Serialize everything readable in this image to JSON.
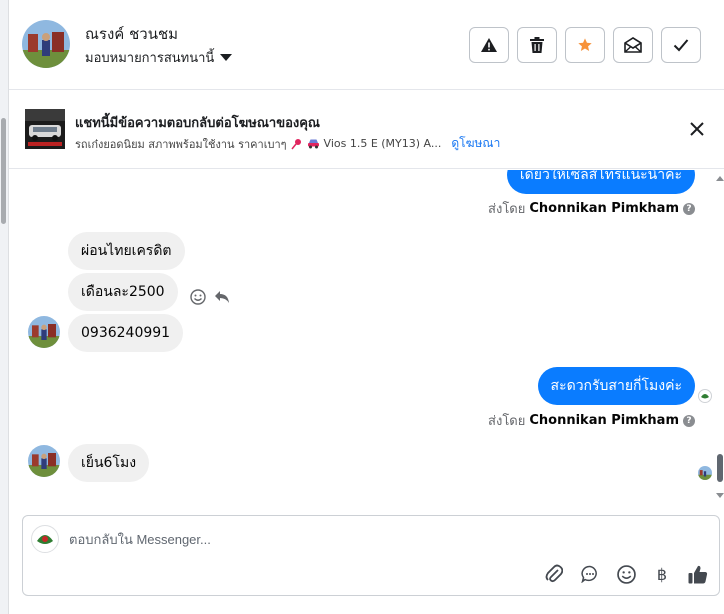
{
  "contact": {
    "name": "ณรงค์ ชวนชม",
    "assign_label": "มอบหมายการสนทนานี้"
  },
  "actions": [
    {
      "icon": "alert-triangle-icon",
      "name": "report-spam-button"
    },
    {
      "icon": "trash-icon",
      "name": "delete-button"
    },
    {
      "icon": "star-icon",
      "name": "star-button"
    },
    {
      "icon": "envelope-open-icon",
      "name": "mark-unread-button"
    },
    {
      "icon": "check-icon",
      "name": "mark-done-button"
    }
  ],
  "ad_banner": {
    "title": "แชทนี้มีข้อความตอบกลับต่อโฆษณาของคุณ",
    "subtitle_before_pin": "รถเก๋งยอดนิยม สภาพพร้อมใช้งาน ราคาเบาๆ",
    "subtitle_after_car": "Vios 1.5 E (MY13) A...",
    "link_label": "ดูโฆษณา"
  },
  "messages": {
    "out_1": "เดี๋ยวให้เซลส์โทรแนะนำค่ะ",
    "sent_by_label": "ส่งโดย",
    "sender_name": "Chonnikan Pimkham",
    "in_1": "ผ่อนไทยเครดิต",
    "in_2": "เดือนละ2500",
    "in_3": "0936240991",
    "out_2": "สะดวกรับสายกี่โมงค่ะ",
    "in_4": "เย็น6โมง"
  },
  "composer": {
    "placeholder": "ตอบกลับใน Messenger...",
    "baht_symbol": "฿"
  },
  "colors": {
    "accent": "#0a7cff",
    "star": "#f7923a",
    "link": "#1877f2"
  }
}
